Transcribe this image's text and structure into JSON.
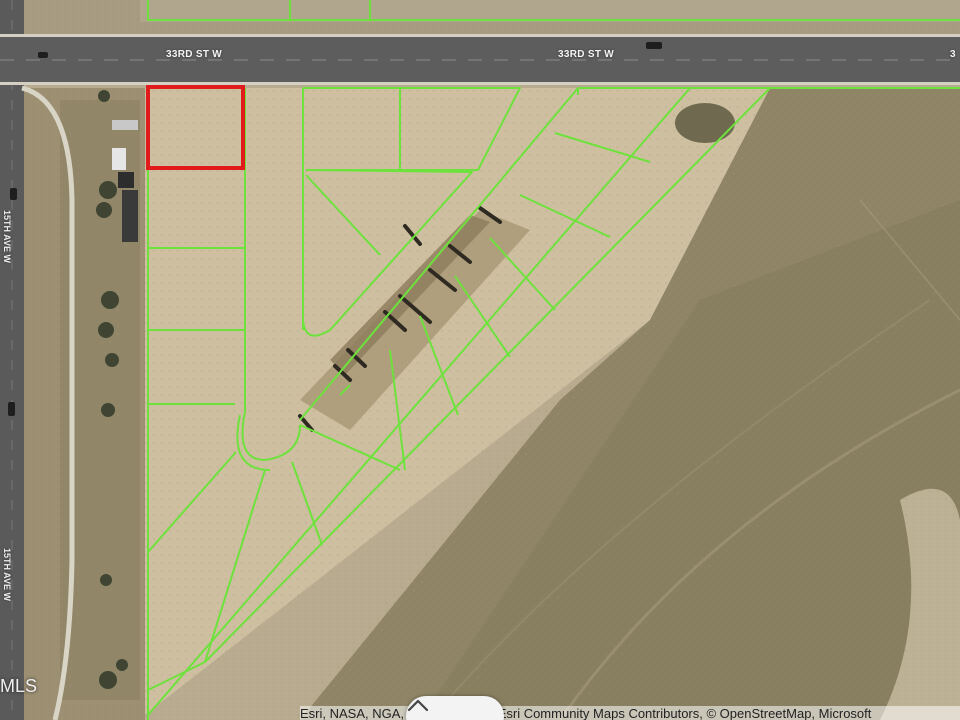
{
  "map": {
    "roads": {
      "horizontal_label": "33RD ST W",
      "horizontal_label_edge": "3",
      "vertical_label_top": "15TH AVE W",
      "vertical_label_bottom": "15TH AVE W"
    },
    "watermark": "MLS",
    "attribution": "Esri, NASA, NGA, USGS, FEMA | Esri Community Maps Contributors, © OpenStreetMap, Microsoft",
    "colors": {
      "parcel_outline": "#6ee23c",
      "selected_parcel": "#e11b1b",
      "road": "#5d5d5d",
      "terrain": "#a89d84"
    },
    "controls": {
      "collapse_icon": "chevron-up-icon"
    }
  }
}
